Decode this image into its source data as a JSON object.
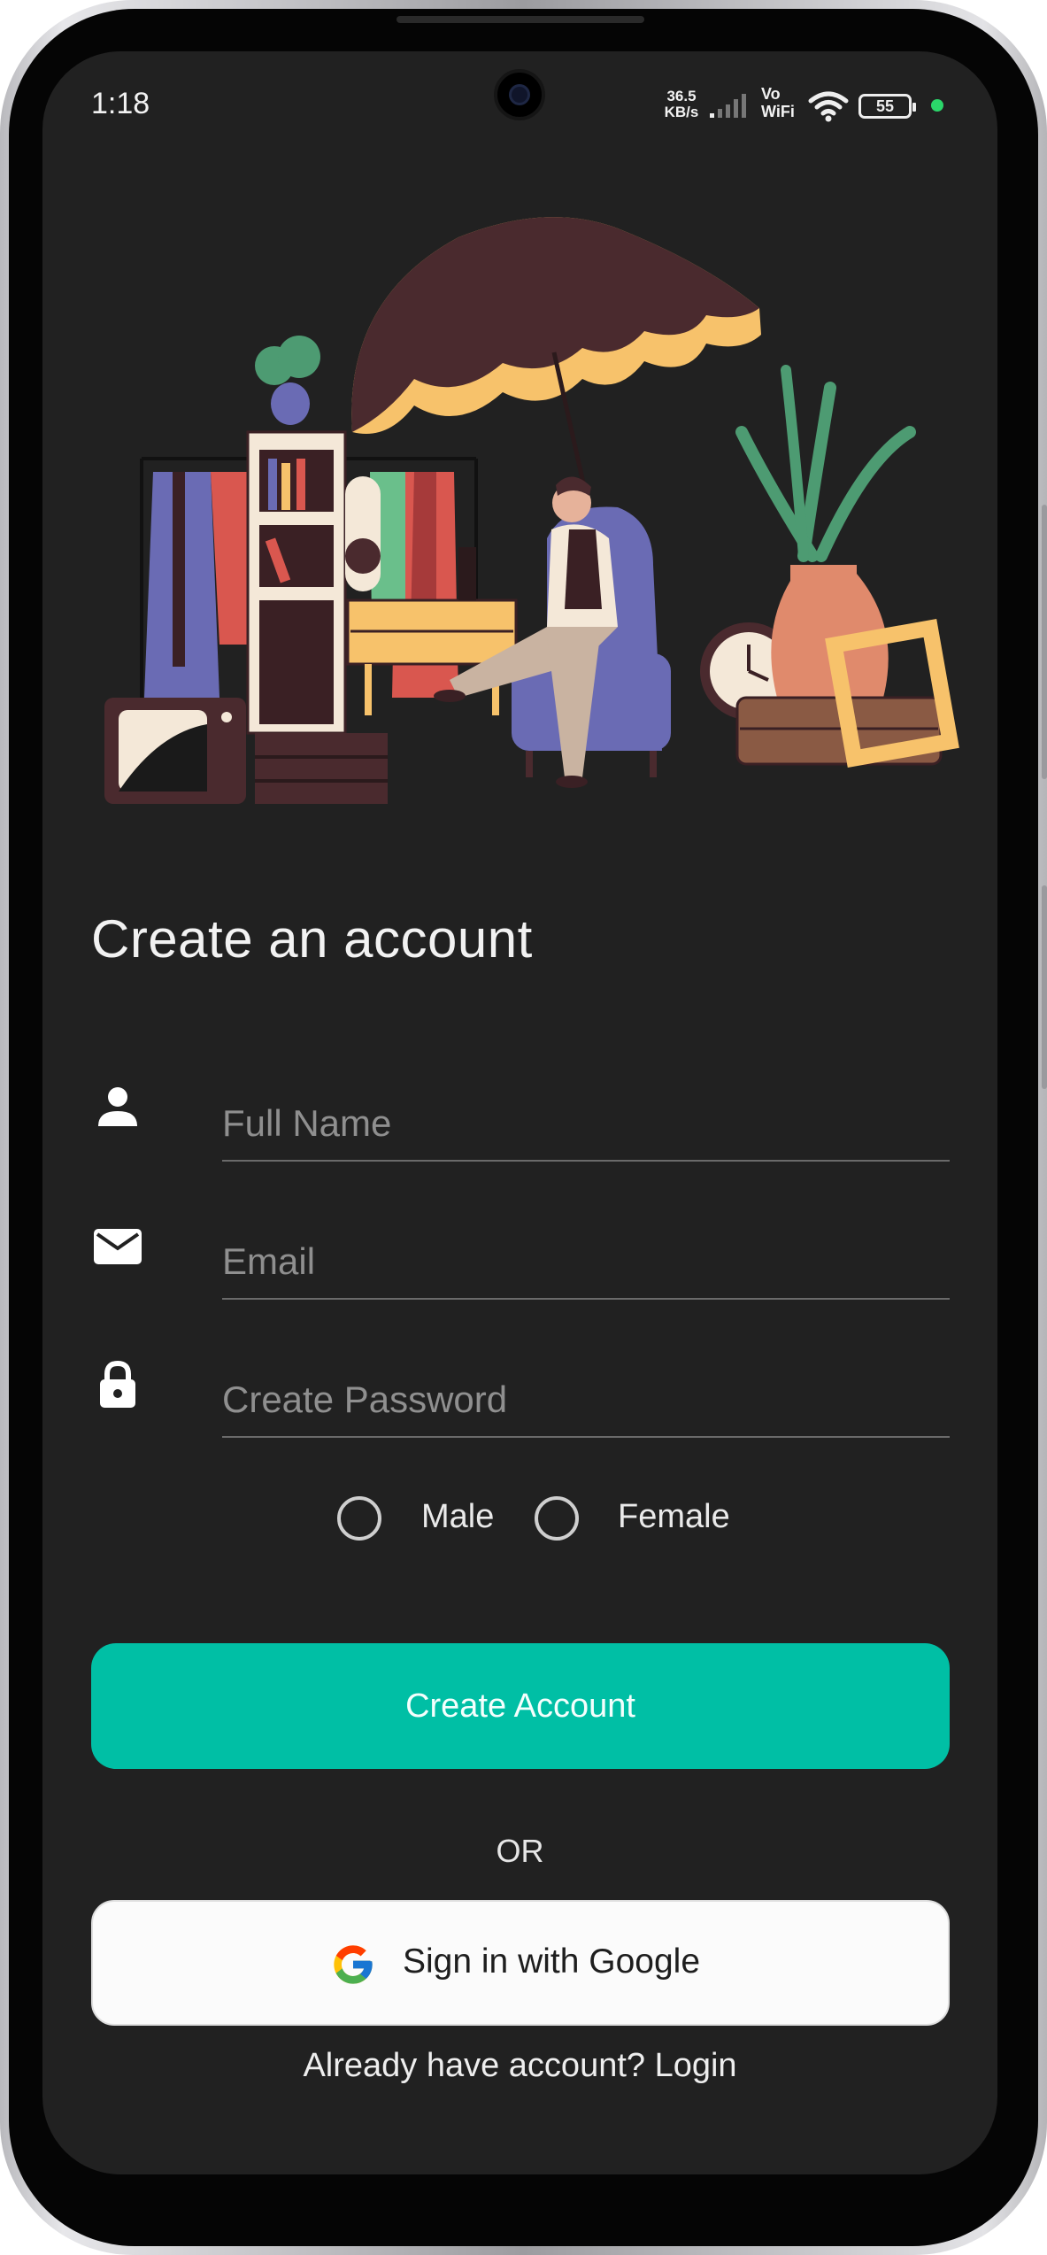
{
  "status_bar": {
    "time": "1:18",
    "net_speed_value": "36.5",
    "net_speed_unit": "KB/s",
    "vowifi_top": "Vo",
    "vowifi_bottom": "WiFi",
    "battery": "55",
    "active_dot_color": "#2bd66a"
  },
  "page": {
    "title": "Create an account"
  },
  "form": {
    "full_name": {
      "placeholder": "Full Name",
      "value": "",
      "icon": "person-icon"
    },
    "email": {
      "placeholder": "Email",
      "value": "",
      "icon": "mail-icon"
    },
    "password": {
      "placeholder": "Create Password",
      "value": "",
      "icon": "lock-icon"
    },
    "gender": {
      "male_label": "Male",
      "female_label": "Female",
      "selected": ""
    }
  },
  "actions": {
    "create_label": "Create Account",
    "or_label": "OR",
    "google_label": "Sign in with Google",
    "login_prompt": "Already have account? Login"
  },
  "colors": {
    "background": "#212121",
    "accent": "#00bfa5",
    "google_button_bg": "#fbfbfb",
    "text_primary": "#f2f2f2",
    "placeholder": "#8f8f8f"
  }
}
